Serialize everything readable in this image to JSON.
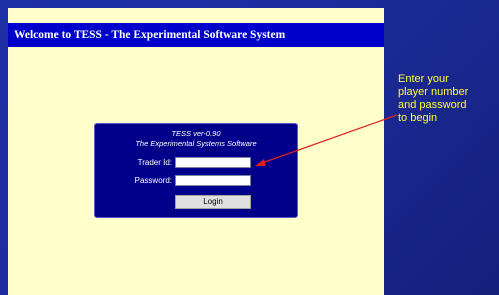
{
  "window": {
    "title": "Welcome to TESS - The Experimental Software System"
  },
  "login": {
    "version": "TESS ver-0.90",
    "subtitle": "The Experimental Systems Software",
    "trader_id_label": "Trader Id:",
    "password_label": "Password:",
    "button_label": "Login"
  },
  "callout": {
    "line1": "Enter your",
    "line2": "player number",
    "line3": "and password",
    "line4": "to begin",
    "color": "#ffff33"
  },
  "colors": {
    "slide_background": "#1f2fa6",
    "page_background": "#ffffcc",
    "title_bar": "#0000cc",
    "login_box": "#00008b",
    "arrow": "#e02020"
  }
}
